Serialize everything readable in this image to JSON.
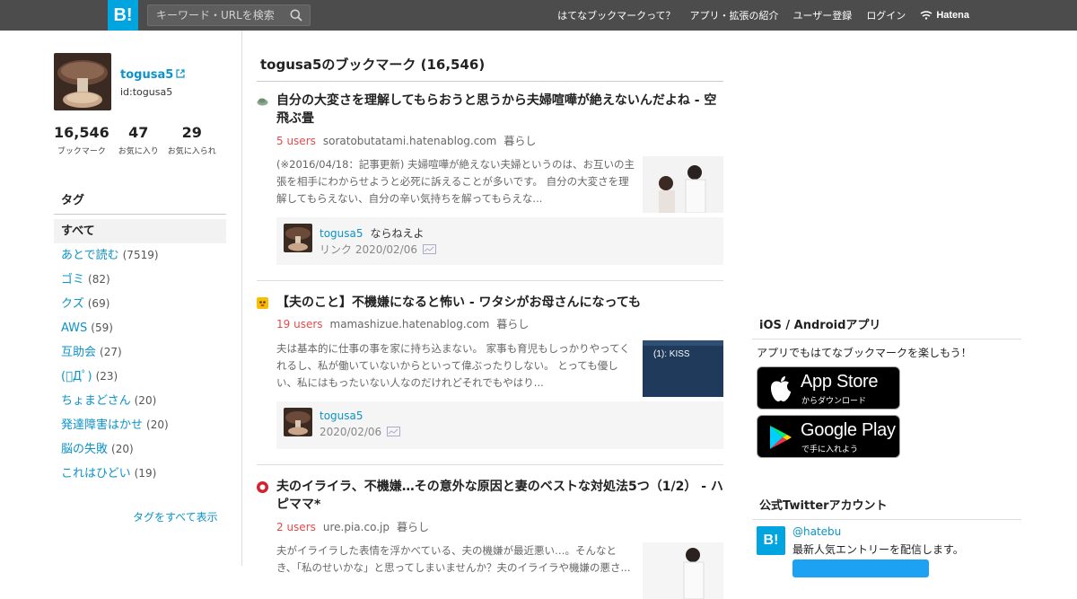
{
  "header": {
    "logo": "B!",
    "search_placeholder": "キーワード・URLを検索",
    "nav": [
      "はてなブックマークって？",
      "アプリ・拡張の紹介",
      "ユーザー登録",
      "ログイン"
    ],
    "hatena": "Hatena"
  },
  "profile": {
    "name": "togusa5",
    "id": "id:togusa5",
    "stats": [
      {
        "num": "16,546",
        "label": "ブックマーク"
      },
      {
        "num": "47",
        "label": "お気に入り"
      },
      {
        "num": "29",
        "label": "お気に入られ"
      }
    ]
  },
  "tags": {
    "heading": "タグ",
    "all": "すべて",
    "items": [
      {
        "name": "あとで読む",
        "count": "(7519)"
      },
      {
        "name": "ゴミ",
        "count": "(82)"
      },
      {
        "name": "クズ",
        "count": "(69)"
      },
      {
        "name": "AWS",
        "count": "(59)"
      },
      {
        "name": "互助会",
        "count": "(27)"
      },
      {
        "name": "(ﾟДﾟ)",
        "count": "(23)"
      },
      {
        "name": "ちょまどさん",
        "count": "(20)"
      },
      {
        "name": "発達障害はかせ",
        "count": "(20)"
      },
      {
        "name": "脳の失敗",
        "count": "(20)"
      },
      {
        "name": "これはひどい",
        "count": "(19)"
      }
    ],
    "show_all": "タグをすべて表示"
  },
  "main": {
    "title": "togusa5のブックマーク (16,546)",
    "entries": [
      {
        "title": "自分の大変さを理解してもらおうと思うから夫婦喧嘩が絶えないんだよね - 空飛ぶ畳",
        "users": "5 users",
        "domain": "soratobutatami.hatenablog.com",
        "category": "暮らし",
        "desc": "(※2016/04/18：記事更新) 夫婦喧嘩が絶えない夫婦というのは、お互いの主張を相手にわからせようと必死に訴えることが多いです。 自分の大変さを理解してもらえない、自分の辛い気持ちを解ってもらえな...",
        "comment_user": "togusa5",
        "comment_text": "ならねえよ",
        "comment_meta": "リンク 2020/02/06"
      },
      {
        "title": "【夫のこと】不機嫌になると怖い - ワタシがお母さんになっても",
        "users": "19 users",
        "domain": "mamashizue.hatenablog.com",
        "category": "暮らし",
        "desc": "夫は基本的に仕事の事を家に持ち込まない。 家事も育児もしっかりやってくれるし、私が働いていないからといって偉ぶったりしない。 とっても優しい、私にはもったいない人なのだけれどそれでもやはり...",
        "thumb_text": "(1): KISS",
        "comment_user": "togusa5",
        "comment_text": "",
        "comment_meta": "2020/02/06"
      },
      {
        "title": "夫のイライラ、不機嫌…その意外な原因と妻のベストな対処法5つ（1/2） - ハピママ*",
        "users": "2 users",
        "domain": "ure.pia.co.jp",
        "category": "暮らし",
        "desc": "夫がイライラした表情を浮かべている、夫の機嫌が最近悪い…。そんなとき、「私のせいかな」と思ってしまいませんか？夫のイライラや機嫌の悪さ..."
      }
    ]
  },
  "right": {
    "app_heading": "iOS / Androidアプリ",
    "app_text": "アプリでもはてなブックマークを楽しもう！",
    "appstore_main": "App Store",
    "appstore_sub": "からダウンロード",
    "gplay_main": "Google Play",
    "gplay_sub": "で手に入れよう",
    "twitter_heading": "公式Twitterアカウント",
    "tw_logo": "B!",
    "tw_handle": "@hatebu",
    "tw_desc": "最新人気エントリーを配信します。"
  },
  "colors": {
    "header_bg": "#4c4c4c",
    "brand": "#00a4de",
    "link": "#0c93c7",
    "users": "#e54a4a"
  }
}
